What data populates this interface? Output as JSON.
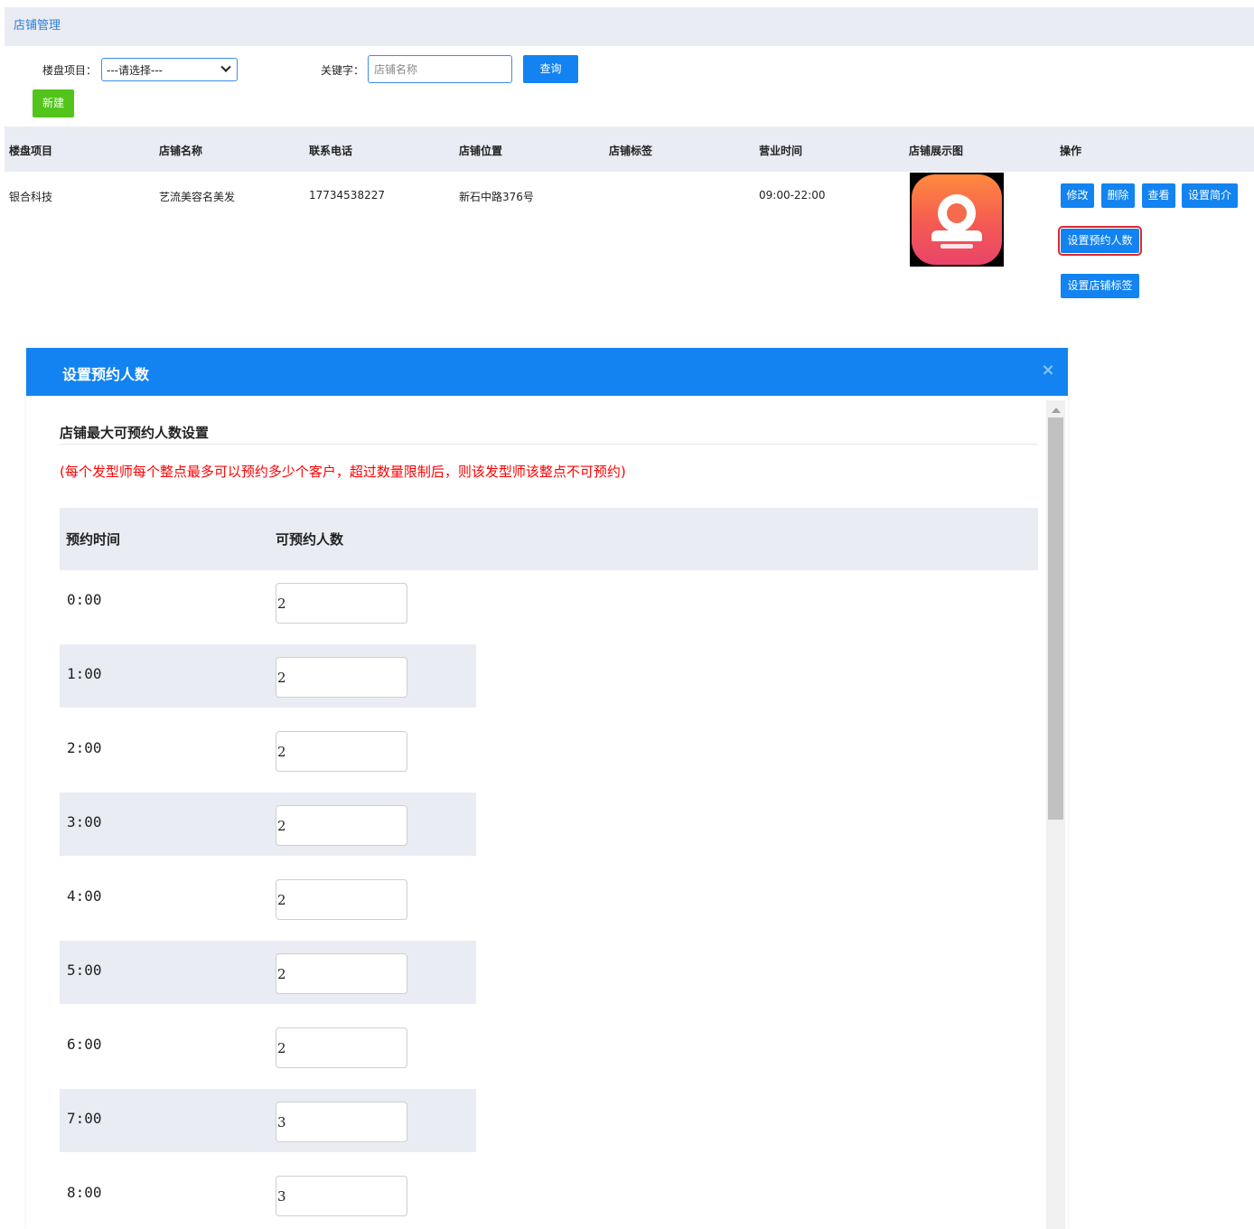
{
  "header": {
    "title": "店铺管理"
  },
  "filters": {
    "project_label": "楼盘项目：",
    "project_value": "---请选择---",
    "keyword_label": "关键字：",
    "keyword_placeholder": "店铺名称",
    "query_label": "查询",
    "new_label": "新建"
  },
  "table": {
    "columns": [
      "楼盘项目",
      "店铺名称",
      "联系电话",
      "店铺位置",
      "店铺标签",
      "营业时间",
      "店铺展示图",
      "操作"
    ],
    "row": {
      "project": "银合科技",
      "name": "艺流美容名美发",
      "phone": "17734538227",
      "location": "新石中路376号",
      "tag": "",
      "hours": "09:00-22:00"
    },
    "actions": {
      "edit": "修改",
      "delete": "删除",
      "view": "查看",
      "set_intro": "设置简介",
      "set_capacity": "设置预约人数",
      "set_tags": "设置店铺标签"
    }
  },
  "modal": {
    "title": "设置预约人数",
    "close": "×",
    "section_title": "店铺最大可预约人数设置",
    "notice": "(每个发型师每个整点最多可以预约多少个客户，超过数量限制后，则该发型师该整点不可预约)",
    "col_time": "预约时间",
    "col_capacity": "可预约人数",
    "rows": [
      {
        "time": "0:00",
        "capacity": "2"
      },
      {
        "time": "1:00",
        "capacity": "2"
      },
      {
        "time": "2:00",
        "capacity": "2"
      },
      {
        "time": "3:00",
        "capacity": "2"
      },
      {
        "time": "4:00",
        "capacity": "2"
      },
      {
        "time": "5:00",
        "capacity": "2"
      },
      {
        "time": "6:00",
        "capacity": "2"
      },
      {
        "time": "7:00",
        "capacity": "3"
      },
      {
        "time": "8:00",
        "capacity": "3"
      }
    ]
  }
}
